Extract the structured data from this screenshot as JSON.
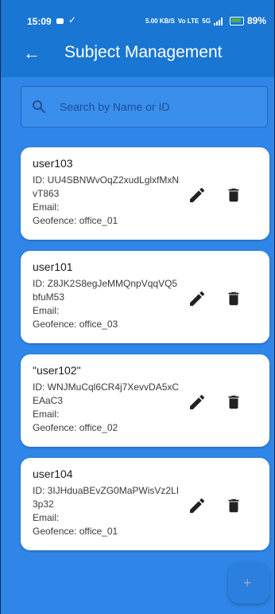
{
  "status_bar": {
    "time": "15:09",
    "network_speed": "5.00 KB/S",
    "network_type": "Vo LTE",
    "signal": "5G",
    "battery": "89%"
  },
  "app_bar": {
    "title": "Subject Management",
    "back_icon": "arrow-back-icon"
  },
  "search": {
    "placeholder": "Search by Name or ID",
    "value": ""
  },
  "subjects": [
    {
      "name": "user103",
      "id_line": "ID: UU4SBNWvOqZ2xudLglxfMxNvT863",
      "email_line": "Email:",
      "geofence_line": "Geofence: office_01"
    },
    {
      "name": "user101",
      "id_line": "ID: Z8JK2S8egJeMMQnpVqqVQ5bfuM53",
      "email_line": "Email:",
      "geofence_line": "Geofence: office_03"
    },
    {
      "name": "\"user102\"",
      "id_line": "ID: WNJMuCql6CR4j7XevvDA5xCEAaC3",
      "email_line": "Email:",
      "geofence_line": "Geofence: office_02"
    },
    {
      "name": "user104",
      "id_line": "ID: 3IJHduaBEvZG0MaPWisVz2LI3p32",
      "email_line": "Email:",
      "geofence_line": "Geofence: office_01"
    }
  ],
  "fab": {
    "label": "+",
    "icon": "add-icon"
  },
  "colors": {
    "app_bar": "#1976d2",
    "background": "#2f86e8",
    "card": "#ffffff",
    "fab": "#2b7fde"
  }
}
